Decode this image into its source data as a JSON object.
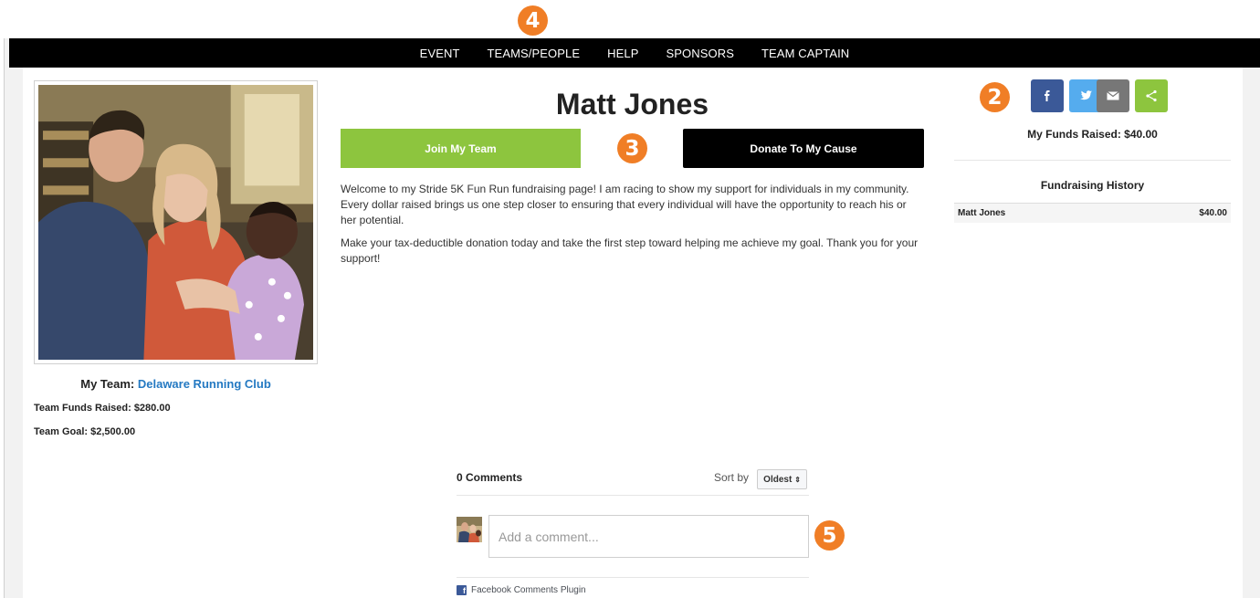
{
  "nav": {
    "items": [
      "EVENT",
      "TEAMS/PEOPLE",
      "HELP",
      "SPONSORS",
      "TEAM CAPTAIN"
    ]
  },
  "badges": {
    "b2": "2",
    "b3": "3",
    "b4": "4",
    "b5": "5"
  },
  "profile": {
    "name": "Matt Jones",
    "team_prefix": "My Team:",
    "team_name": "Delaware Running Club",
    "team_funds": "Team Funds Raised: $280.00",
    "team_goal": "Team Goal: $2,500.00"
  },
  "buttons": {
    "join": "Join My Team",
    "donate": "Donate To My Cause"
  },
  "description": {
    "p1": "Welcome to my Stride 5K Fun Run fundraising page! I am racing to show my support for individuals in my community. Every dollar raised brings us one step closer to ensuring that every individual will have the opportunity to reach his or her potential.",
    "p2": "Make your tax-deductible donation today and take the first step toward helping me achieve my goal. Thank you for your support!"
  },
  "social": {
    "icons": [
      "facebook-icon",
      "twitter-icon",
      "email-icon",
      "share-icon"
    ],
    "colors": {
      "facebook": "#3b5998",
      "twitter": "#55acee",
      "email": "#777777",
      "share": "#8dc53e"
    }
  },
  "sidebar": {
    "funds_raised": "My Funds Raised: $40.00",
    "history_title": "Fundraising History",
    "history": [
      {
        "name": "Matt Jones",
        "amount": "$40.00"
      }
    ]
  },
  "comments": {
    "count": "0 Comments",
    "sort_label": "Sort by",
    "sort_value": "Oldest",
    "placeholder": "Add a comment...",
    "plugin_label": "Facebook Comments Plugin"
  },
  "colors": {
    "accent_orange": "#f07e26",
    "join_green": "#8dc53e",
    "link_blue": "#2479c2",
    "nav_black": "#000000"
  }
}
